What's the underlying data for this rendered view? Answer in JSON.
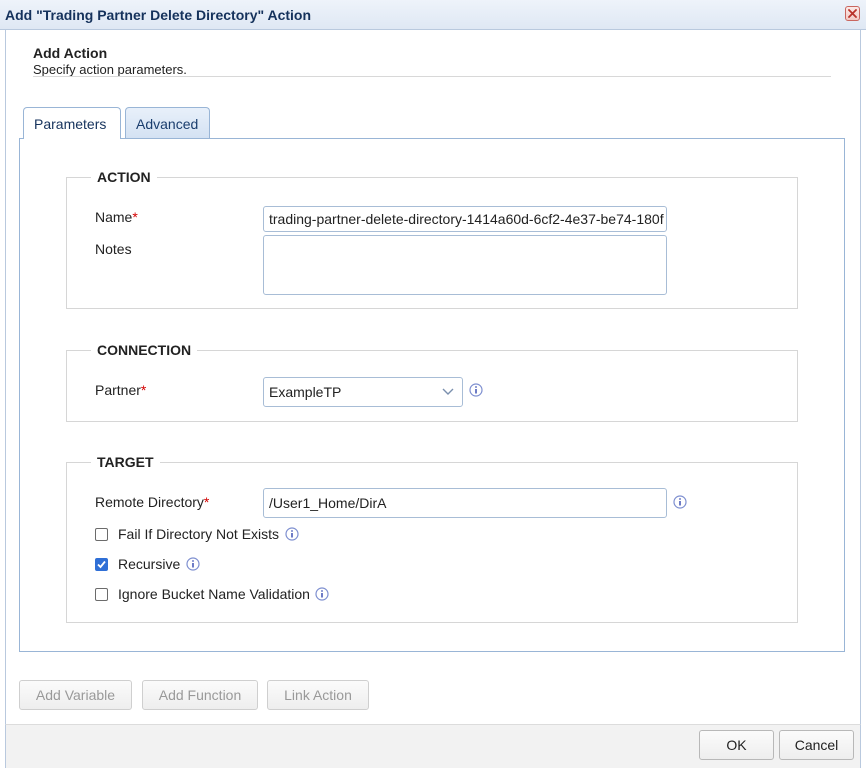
{
  "dialog": {
    "title": "Add \"Trading Partner Delete Directory\" Action",
    "header_title": "Add Action",
    "header_subtitle": "Specify action parameters."
  },
  "tabs": [
    {
      "label": "Parameters",
      "active": true
    },
    {
      "label": "Advanced",
      "active": false
    }
  ],
  "action": {
    "legend": "ACTION",
    "name_label": "Name",
    "name_value": "trading-partner-delete-directory-1414a60d-6cf2-4e37-be74-180f",
    "notes_label": "Notes",
    "notes_value": ""
  },
  "connection": {
    "legend": "CONNECTION",
    "partner_label": "Partner",
    "partner_value": "ExampleTP"
  },
  "target": {
    "legend": "TARGET",
    "remote_dir_label": "Remote Directory",
    "remote_dir_value": "/User1_Home/DirA",
    "fail_label": "Fail If Directory Not Exists",
    "fail_checked": false,
    "recursive_label": "Recursive",
    "recursive_checked": true,
    "ignore_label": "Ignore Bucket Name Validation",
    "ignore_checked": false
  },
  "bottom_buttons": {
    "add_variable": "Add Variable",
    "add_function": "Add Function",
    "link_action": "Link Action"
  },
  "footer": {
    "ok": "OK",
    "cancel": "Cancel"
  },
  "required_marker": "*",
  "icons": {
    "close": "close-icon",
    "info": "info-icon",
    "dropdown": "chevron-down-icon",
    "check": "checkmark-icon"
  },
  "colors": {
    "title_text": "#15325c",
    "required": "#d40000",
    "checkbox_checked": "#2f6fd6",
    "tab_border": "#99b5d6"
  }
}
